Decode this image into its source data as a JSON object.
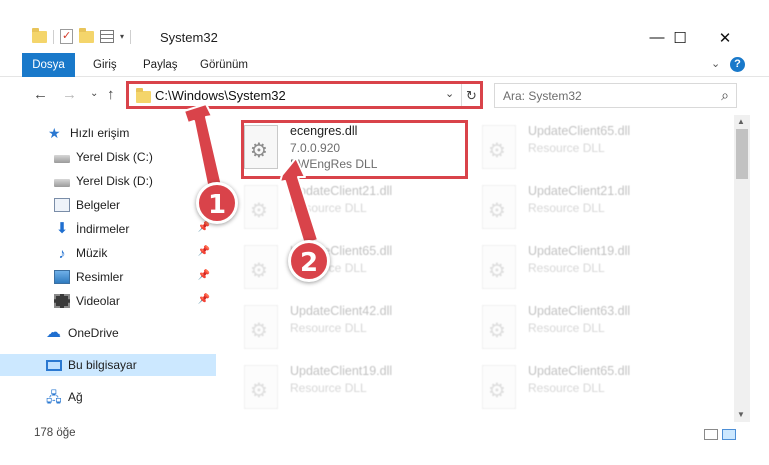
{
  "window": {
    "title": "System32",
    "minimize_glyph": "—",
    "maximize_glyph": "☐",
    "close_glyph": "✕"
  },
  "ribbon": {
    "tabs": [
      "Dosya",
      "Giriş",
      "Paylaş",
      "Görünüm"
    ],
    "expand_glyph": "⌄",
    "help_glyph": "?"
  },
  "navigation": {
    "back_glyph": "←",
    "forward_glyph": "→",
    "recent_glyph": "⌄",
    "up_glyph": "↑",
    "address": "C:\\Windows\\System32",
    "address_dropdown_glyph": "⌄",
    "refresh_glyph": "↻",
    "search_placeholder": "Ara: System32",
    "search_glyph": "⌕"
  },
  "sidebar": {
    "items": [
      {
        "label": "Hızlı erişim",
        "icon": "star-icon"
      },
      {
        "label": "Yerel Disk (C:)",
        "icon": "disk-icon"
      },
      {
        "label": "Yerel Disk (D:)",
        "icon": "disk-icon"
      },
      {
        "label": "Belgeler",
        "icon": "document-icon"
      },
      {
        "label": "İndirmeler",
        "icon": "download-icon"
      },
      {
        "label": "Müzik",
        "icon": "music-icon"
      },
      {
        "label": "Resimler",
        "icon": "pictures-icon"
      },
      {
        "label": "Videolar",
        "icon": "videos-icon"
      },
      {
        "label": "OneDrive",
        "icon": "cloud-icon"
      },
      {
        "label": "Bu bilgisayar",
        "icon": "computer-icon"
      },
      {
        "label": "Ağ",
        "icon": "network-icon"
      }
    ],
    "pin_glyph": "📌"
  },
  "files": {
    "highlighted": {
      "name": "ecengres.dll",
      "version": "7.0.0.920",
      "description": "PWEngRes DLL"
    },
    "others": [
      {
        "name": "UpdateClient65.dll",
        "description": "Resource DLL"
      },
      {
        "name": "UpdateClient21.dll",
        "description": "Resource DLL"
      },
      {
        "name": "UpdateClient21.dll",
        "description": "Resource DLL"
      },
      {
        "name": "UpdateClient65.dll",
        "description": "Resource DLL"
      },
      {
        "name": "UpdateClient19.dll",
        "description": "Resource DLL"
      },
      {
        "name": "UpdateClient42.dll",
        "description": "Resource DLL"
      },
      {
        "name": "UpdateClient63.dll",
        "description": "Resource DLL"
      },
      {
        "name": "UpdateClient19.dll",
        "description": "Resource DLL"
      },
      {
        "name": "UpdateClient65.dll",
        "description": "Resource DLL"
      }
    ]
  },
  "status": {
    "item_count": "178 öğe"
  },
  "callouts": {
    "step1": "1",
    "step2": "2"
  },
  "colors": {
    "accent": "#1979ca",
    "highlight": "#d9434a",
    "selection": "#cce8ff"
  }
}
